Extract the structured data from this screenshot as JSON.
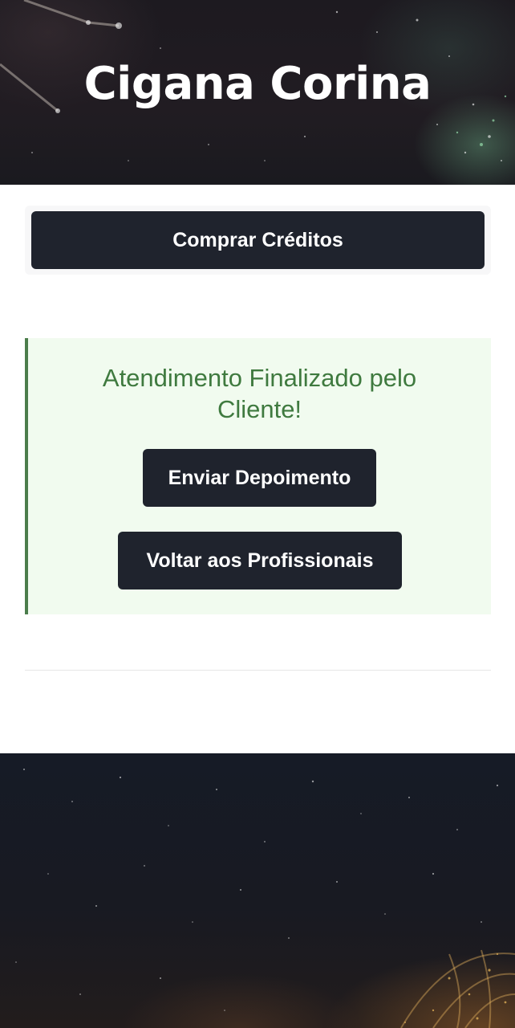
{
  "header": {
    "title": "Cigana Corina"
  },
  "actions": {
    "buy_credits_label": "Comprar Créditos"
  },
  "notice": {
    "message": "Atendimento Finalizado pelo Cliente!",
    "send_testimonial_label": "Enviar Depoimento",
    "back_to_professionals_label": "Voltar aos Profissionais"
  },
  "colors": {
    "button_bg": "#1f232d",
    "notice_bg": "#f1fbef",
    "notice_accent": "#4b7d4b",
    "notice_text": "#3f7a3f"
  }
}
